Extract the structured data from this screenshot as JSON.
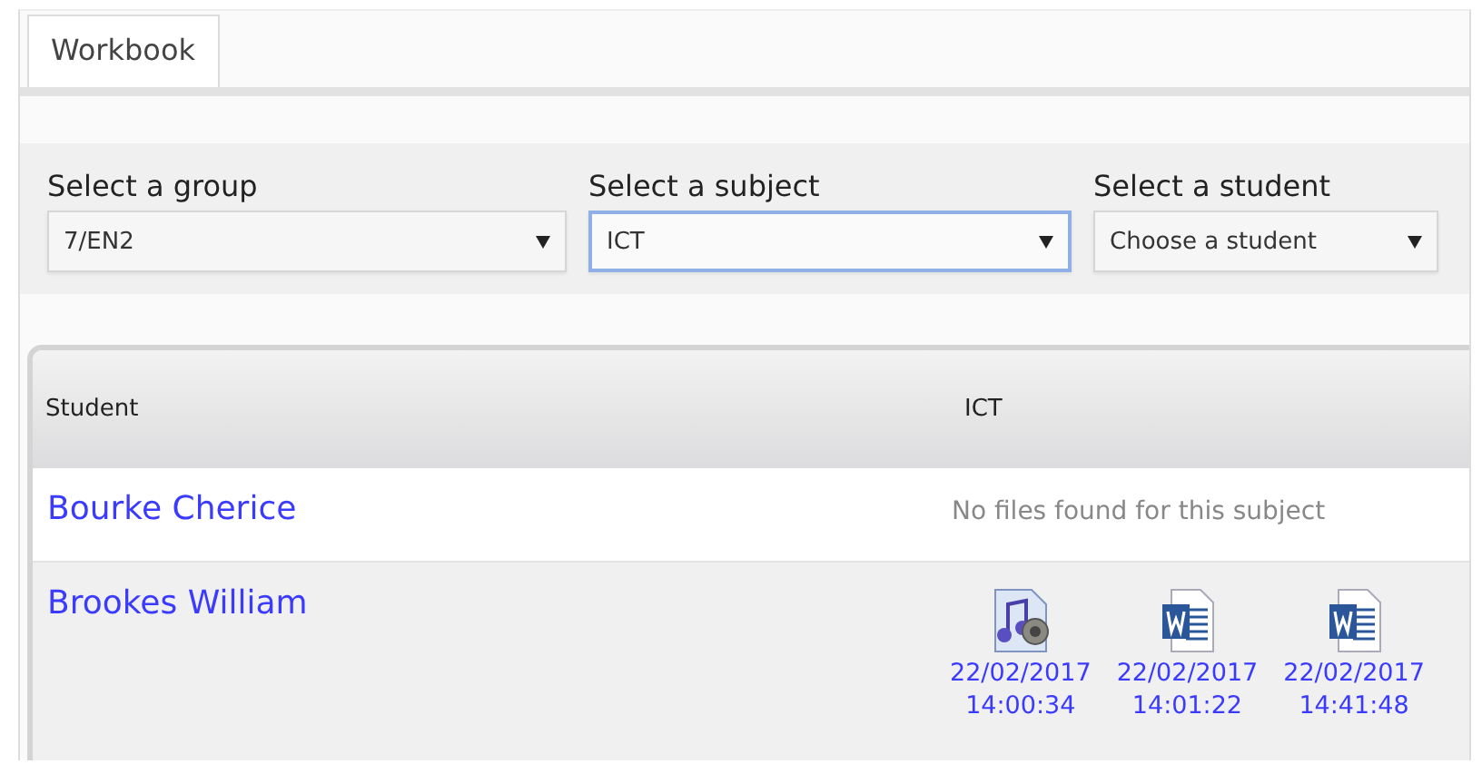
{
  "tabs": [
    {
      "label": "Workbook",
      "selected": true
    }
  ],
  "filters": [
    {
      "label": "Select a group",
      "value": "7/EN2",
      "focused": false
    },
    {
      "label": "Select a subject",
      "value": "ICT",
      "focused": true
    },
    {
      "label": "Select a student",
      "value": "Choose a student",
      "focused": false
    }
  ],
  "table": {
    "columns": [
      "Student",
      "ICT"
    ],
    "rows": [
      {
        "student": "Bourke Cherice",
        "message": "No files found for this subject",
        "files": []
      },
      {
        "student": "Brookes William",
        "files": [
          {
            "kind": "audio",
            "date": "22/02/2017",
            "time": "14:00:34"
          },
          {
            "kind": "word",
            "date": "22/02/2017",
            "time": "14:01:22"
          },
          {
            "kind": "word",
            "date": "22/02/2017",
            "time": "14:41:48"
          }
        ]
      }
    ]
  }
}
